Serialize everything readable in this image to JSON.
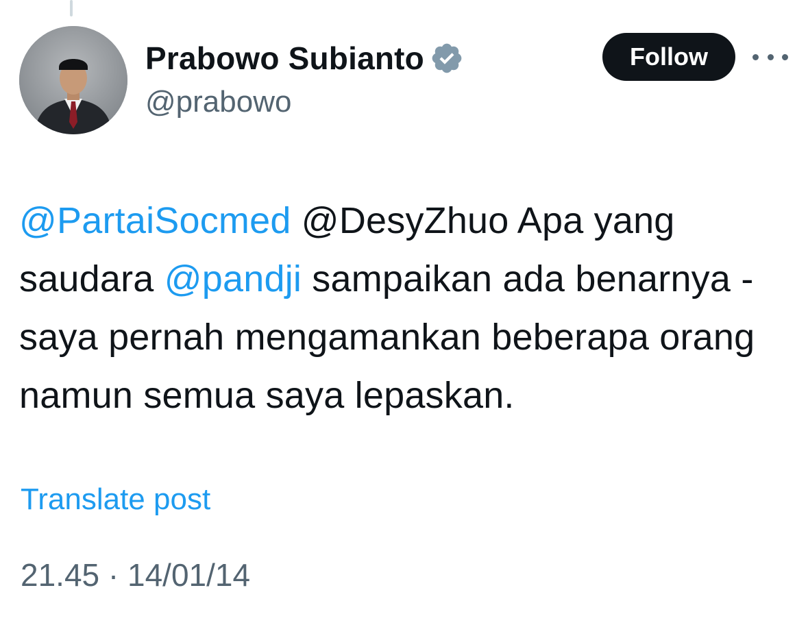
{
  "author": {
    "display_name": "Prabowo Subianto",
    "handle": "@prabowo",
    "verified": true,
    "avatar": "profile-photo"
  },
  "actions": {
    "follow_label": "Follow",
    "more_icon": "more-horizontal-icon"
  },
  "tweet": {
    "mention_1": "@PartaiSocmed",
    "text_1": " @DesyZhuo Apa yang saudara ",
    "mention_2": "@pandji",
    "text_2": " sampaikan ada benarnya - saya pernah mengamankan beberapa orang namun semua saya lepaskan."
  },
  "translate_label": "Translate post",
  "meta": {
    "time": "21.45",
    "separator": " · ",
    "date": "14/01/14"
  },
  "colors": {
    "link": "#1d9bf0",
    "secondary_text": "#536471",
    "primary_text": "#0f1419",
    "follow_bg": "#0f1419",
    "verified_badge": "#829aab"
  }
}
